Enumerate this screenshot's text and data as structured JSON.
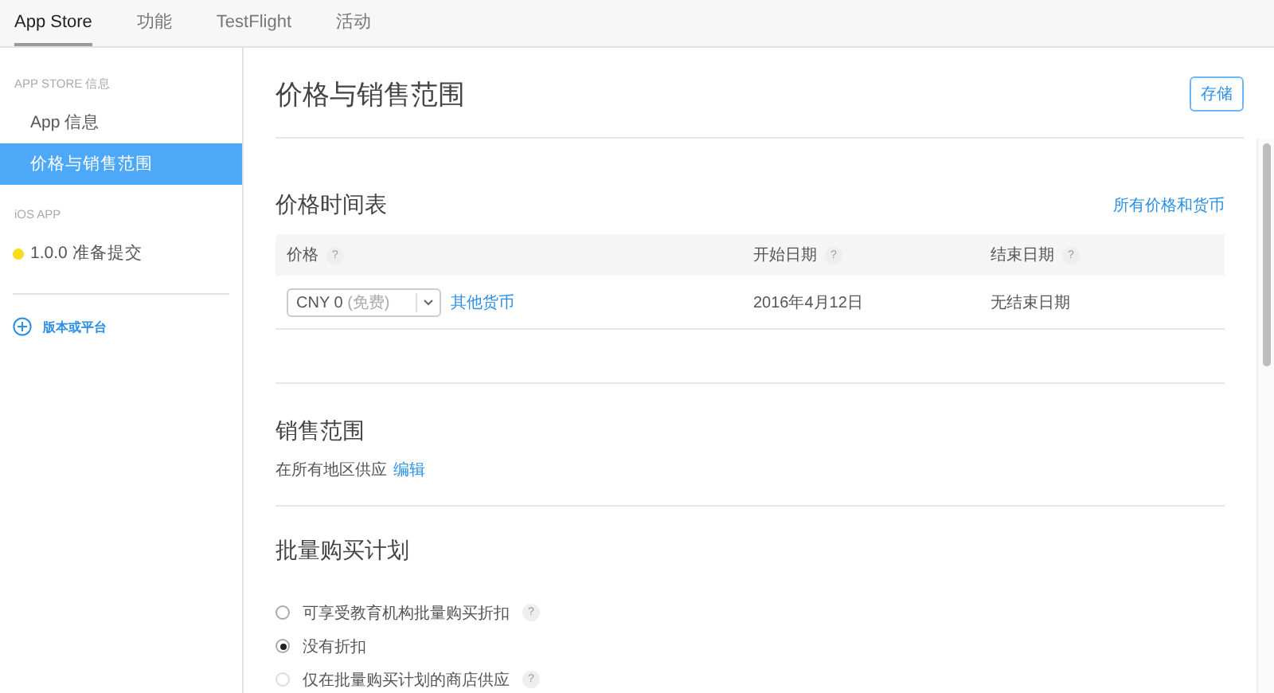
{
  "tabs": [
    {
      "label": "App Store",
      "selected": true
    },
    {
      "label": "功能",
      "selected": false
    },
    {
      "label": "TestFlight",
      "selected": false
    },
    {
      "label": "活动",
      "selected": false
    }
  ],
  "sidebar": {
    "sections": [
      {
        "title": "APP STORE 信息",
        "items": [
          {
            "label": "App 信息",
            "selected": false
          },
          {
            "label": "价格与销售范围",
            "selected": true
          }
        ]
      },
      {
        "title": "iOS APP",
        "items": [
          {
            "label": "1.0.0 准备提交",
            "selected": false,
            "color": "#f7dc1e"
          }
        ]
      }
    ],
    "add_button": "版本或平台"
  },
  "page": {
    "title": "价格与销售范围",
    "save_button": "存储"
  },
  "price_schedule": {
    "title": "价格时间表",
    "link": "所有价格和货币",
    "columns": [
      {
        "label": "价格",
        "hint": "?"
      },
      {
        "label": "开始日期",
        "hint": "?"
      },
      {
        "label": "结束日期",
        "hint": "?"
      }
    ],
    "rows": [
      {
        "price": "CNY 0",
        "price_note": "(免费)",
        "other_link": "其他货币",
        "start": "2016年4月12日",
        "end": "无结束日期"
      }
    ]
  },
  "availability": {
    "title": "销售范围",
    "text": "在所有地区供应",
    "edit_link": "编辑"
  },
  "volume_purchase": {
    "title": "批量购买计划",
    "options": [
      {
        "label": "可享受教育机构批量购买折扣",
        "selected": false,
        "disabled": false,
        "hint": "?"
      },
      {
        "label": "没有折扣",
        "selected": true,
        "disabled": false
      },
      {
        "label": "仅在批量购买计划的商店供应",
        "selected": false,
        "disabled": true,
        "hint": "?"
      }
    ]
  }
}
